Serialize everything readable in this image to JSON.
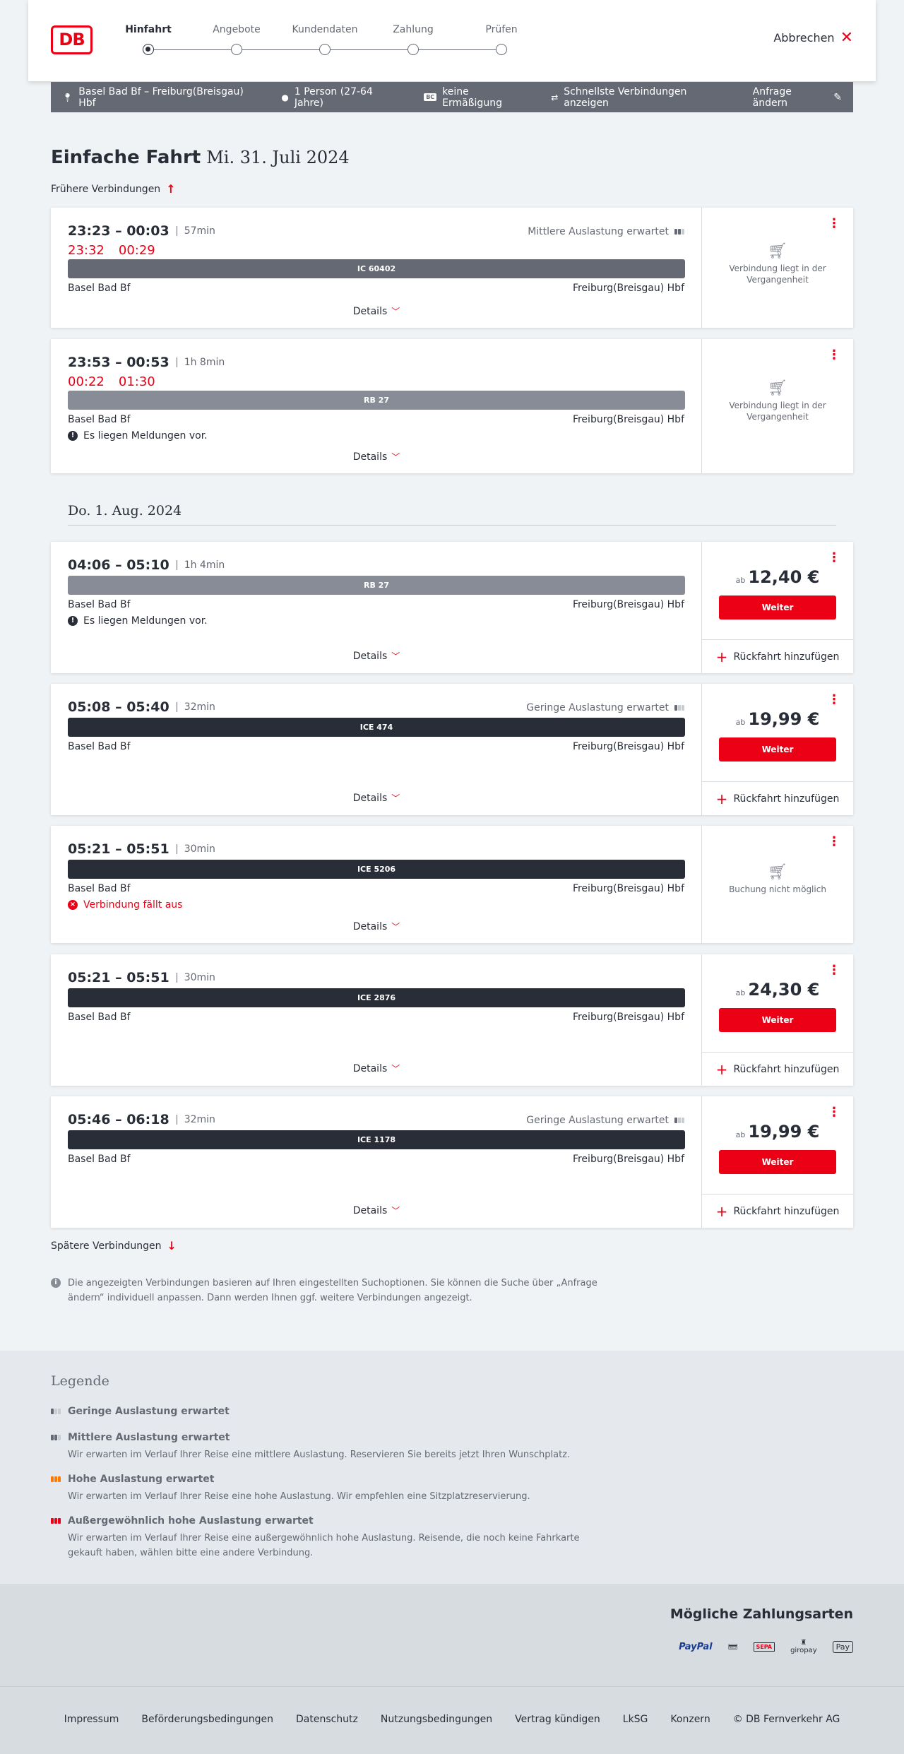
{
  "header": {
    "logo": "DB",
    "steps": [
      {
        "label": "Hinfahrt",
        "active": true
      },
      {
        "label": "Angebote",
        "active": false
      },
      {
        "label": "Kundendaten",
        "active": false
      },
      {
        "label": "Zahlung",
        "active": false
      },
      {
        "label": "Prüfen",
        "active": false
      }
    ],
    "cancel_label": "Abbrechen",
    "cancel_icon": "close-icon"
  },
  "query": {
    "route": "Basel Bad Bf – Freiburg(Breisgau) Hbf",
    "persons": "1 Person (27-64 Jahre)",
    "discount_badge": "BC",
    "discount": "keine Ermäßigung",
    "fastest": "Schnellste Verbindungen anzeigen",
    "change": "Anfrage ändern"
  },
  "title": {
    "trip": "Einfache Fahrt",
    "date": "Mi. 31. Juli 2024"
  },
  "earlier": "Frühere Verbindungen",
  "later": "Spätere Verbindungen",
  "day2": "Do. 1. Aug. 2024",
  "details_label": "Details",
  "weiter_label": "Weiter",
  "return_label": "Rückfahrt hinzufügen",
  "price_prefix": "ab",
  "connections": [
    {
      "times": "23:23 – 00:03",
      "duration": "57min",
      "realtime": [
        "23:32",
        "00:29"
      ],
      "load": "Mittlere Auslastung erwartet",
      "train": "IC 60402",
      "from": "Basel Bad Bf",
      "to": "Freiburg(Breisgau) Hbf",
      "side": "Verbindung liegt in der Vergangenheit"
    },
    {
      "times": "23:53 – 00:53",
      "duration": "1h 8min",
      "realtime": [
        "00:22",
        "01:30"
      ],
      "train": "RB 27",
      "from": "Basel Bad Bf",
      "to": "Freiburg(Breisgau) Hbf",
      "notice": "Es liegen Meldungen vor.",
      "side": "Verbindung liegt in der Vergangenheit"
    },
    {
      "times": "04:06 – 05:10",
      "duration": "1h 4min",
      "train": "RB 27",
      "from": "Basel Bad Bf",
      "to": "Freiburg(Breisgau) Hbf",
      "notice": "Es liegen Meldungen vor.",
      "price": "12,40 €"
    },
    {
      "times": "05:08 – 05:40",
      "duration": "32min",
      "load": "Geringe Auslastung erwartet",
      "train": "ICE 474",
      "from": "Basel Bad Bf",
      "to": "Freiburg(Breisgau) Hbf",
      "price": "19,99 €"
    },
    {
      "times": "05:21 – 05:51",
      "duration": "30min",
      "train": "ICE 5206",
      "from": "Basel Bad Bf",
      "to": "Freiburg(Breisgau) Hbf",
      "notice": "Verbindung fällt aus",
      "side": "Buchung nicht möglich"
    },
    {
      "times": "05:21 – 05:51",
      "duration": "30min",
      "train": "ICE 2876",
      "from": "Basel Bad Bf",
      "to": "Freiburg(Breisgau) Hbf",
      "price": "24,30 €"
    },
    {
      "times": "05:46 – 06:18",
      "duration": "32min",
      "load": "Geringe Auslastung erwartet",
      "train": "ICE 1178",
      "from": "Basel Bad Bf",
      "to": "Freiburg(Breisgau) Hbf",
      "price": "19,99 €"
    }
  ],
  "info": "Die angezeigten Verbindungen basieren auf Ihren eingestellten Suchoptionen. Sie können die Suche über „Anfrage ändern“ individuell anpassen. Dann werden Ihnen ggf. weitere Verbindungen angezeigt.",
  "legend": {
    "title": "Legende",
    "items": [
      {
        "head": "Geringe Auslastung erwartet",
        "desc": ""
      },
      {
        "head": "Mittlere Auslastung erwartet",
        "desc": "Wir erwarten im Verlauf Ihrer Reise eine mittlere Auslastung. Reservieren Sie bereits jetzt Ihren Wunschplatz."
      },
      {
        "head": "Hohe Auslastung erwartet",
        "desc": "Wir erwarten im Verlauf Ihrer Reise eine hohe Auslastung. Wir empfehlen eine Sitzplatzreservierung."
      },
      {
        "head": "Außergewöhnlich hohe Auslastung erwartet",
        "desc": "Wir erwarten im Verlauf Ihrer Reise eine außergewöhnlich hohe Auslastung. Reisende, die noch keine Fahrkarte gekauft haben, wählen bitte eine andere Verbindung."
      }
    ]
  },
  "payment": {
    "title": "Mögliche Zahlungsarten",
    "methods": [
      "PayPal",
      "SEPA",
      "giropay",
      "Pay"
    ]
  },
  "footer": {
    "links": [
      "Impressum",
      "Beförderungsbedingungen",
      "Datenschutz",
      "Nutzungsbedingungen",
      "Vertrag kündigen",
      "LkSG",
      "Konzern"
    ],
    "copyright": "© DB Fernverkehr AG"
  },
  "colors": {
    "brand_red": "#ec0016",
    "dark": "#282d37",
    "grey": "#646973"
  }
}
